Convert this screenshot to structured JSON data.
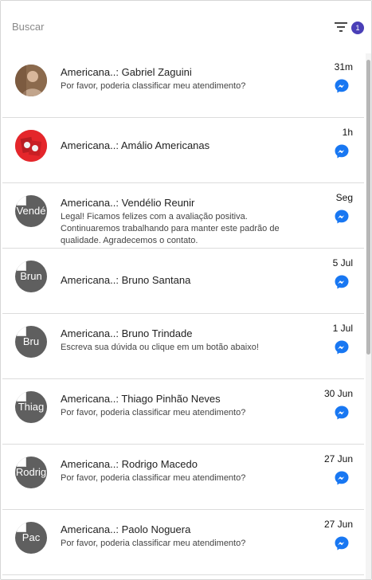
{
  "header": {
    "search_placeholder": "Buscar",
    "filter_badge_count": "1",
    "filter_icon": "filter-list-icon"
  },
  "conversations": [
    {
      "name": "Americana..: Gabriel Zaguini",
      "preview": "Por favor, poderia classificar meu atendimento?",
      "time": "31m",
      "avatar_type": "photo",
      "avatar_alt": "",
      "icon": "messenger-icon"
    },
    {
      "name": "Americana..: Amálio Americanas",
      "preview": "",
      "time": "1h",
      "avatar_type": "logo",
      "avatar_alt": "",
      "icon": "messenger-icon"
    },
    {
      "name": "Americana..: Vendélio Reunir",
      "preview": "Legal! Ficamos felizes com a avaliação positiva. Continuaremos trabalhando para manter este padrão de qualidade. Agradecemos o contato.",
      "time": "Seg",
      "avatar_type": "broken",
      "avatar_alt": "Vendé",
      "icon": "messenger-icon"
    },
    {
      "name": "Americana..: Bruno Santana",
      "preview": "",
      "time": "5 Jul",
      "avatar_type": "broken",
      "avatar_alt": "Brun",
      "icon": "messenger-icon"
    },
    {
      "name": "Americana..: Bruno Trindade",
      "preview": "Escreva sua dúvida ou clique em um botão abaixo!",
      "time": "1 Jul",
      "avatar_type": "broken",
      "avatar_alt": "Bru Trinda",
      "icon": "messenger-icon"
    },
    {
      "name": "Americana..: Thiago Pinhão Neves",
      "preview": "Por favor, poderia classificar meu atendimento?",
      "time": "30 Jun",
      "avatar_type": "broken",
      "avatar_alt": "Thiag",
      "icon": "messenger-icon"
    },
    {
      "name": "Americana..: Rodrigo Macedo",
      "preview": "Por favor, poderia classificar meu atendimento?",
      "time": "27 Jun",
      "avatar_type": "broken",
      "avatar_alt": "Rodrig",
      "icon": "messenger-icon"
    },
    {
      "name": "Americana..: Paolo Noguera",
      "preview": "Por favor, poderia classificar meu atendimento?",
      "time": "27 Jun",
      "avatar_type": "broken",
      "avatar_alt": "Pac Nogu",
      "icon": "messenger-icon"
    }
  ],
  "colors": {
    "badge": "#4a3fb7",
    "messenger": "#1877f2",
    "avatar_placeholder": "#5f5f5f",
    "logo_red": "#e4262b"
  }
}
